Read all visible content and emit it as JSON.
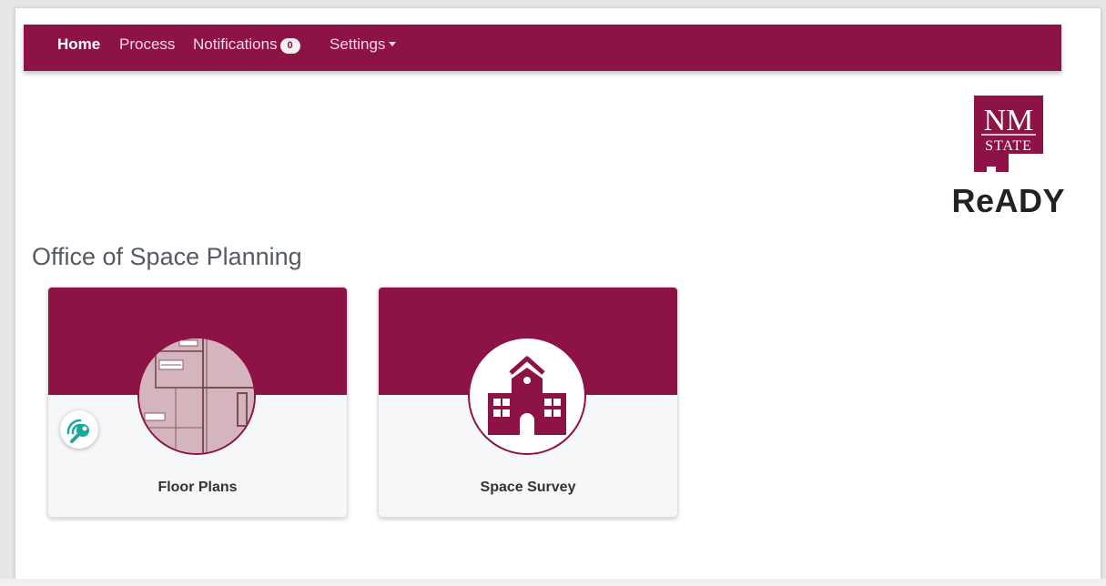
{
  "nav": {
    "items": [
      {
        "label": "Home",
        "active": true
      },
      {
        "label": "Process"
      },
      {
        "label": "Notifications",
        "badge": "0"
      },
      {
        "label": "Settings",
        "dropdown": true
      }
    ]
  },
  "brand": {
    "logo_line1": "NM",
    "logo_line2": "STATE",
    "app_name": "ReADY"
  },
  "section": {
    "title": "Office of Space Planning"
  },
  "cards": [
    {
      "label": "Floor Plans",
      "icon": "floor-plan-icon"
    },
    {
      "label": "Space Survey",
      "icon": "school-building-icon"
    }
  ],
  "colors": {
    "brand": "#8d1245",
    "card_bg": "#f6f7f9",
    "helper_accent": "#1aa89a"
  }
}
